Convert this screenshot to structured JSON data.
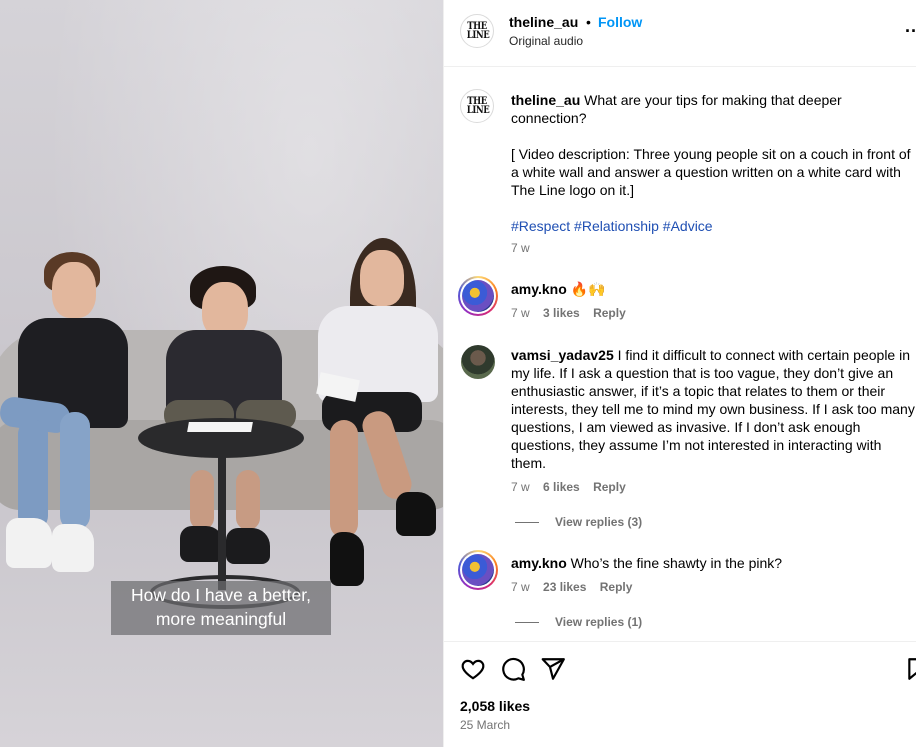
{
  "video": {
    "subtitle": "How do I have a better, more meaningful"
  },
  "header": {
    "logo_text": "THE LINE",
    "username": "theline_au",
    "separator": "•",
    "follow_label": "Follow",
    "audio_label": "Original audio",
    "more_label": "..."
  },
  "caption": {
    "logo_text": "THE LINE",
    "username": "theline_au",
    "text": "What are your tips for making that deeper connection?",
    "description": "[ Video description: Three young people sit on a couch in front of a white wall and answer a question written on a white card with The Line logo on it.]",
    "hashtags": [
      "#Respect",
      "#Relationship",
      "#Advice"
    ],
    "time": "7 w"
  },
  "comments": [
    {
      "username": "amy.kno",
      "text": "🔥🙌",
      "time": "7 w",
      "likes": "3 likes",
      "reply_label": "Reply",
      "view_replies": ""
    },
    {
      "username": "vamsi_yadav25",
      "text": "I find it difficult to connect with certain people in my life. If I ask a question that is too vague, they don’t give an enthusiastic answer, if it’s a topic that relates to them or their interests, they tell me to mind my own business. If I ask too many questions, I am viewed as invasive. If I don’t ask enough questions, they assume I’m not interested in interacting with them.",
      "time": "7 w",
      "likes": "6 likes",
      "reply_label": "Reply",
      "view_replies": "View replies (3)"
    },
    {
      "username": "amy.kno",
      "text": "Who’s the fine shawty in the pink?",
      "time": "7 w",
      "likes": "23 likes",
      "reply_label": "Reply",
      "view_replies": "View replies (1)"
    }
  ],
  "footer": {
    "likes": "2,058 likes",
    "date": "25 March",
    "icons": [
      "heart-icon",
      "comment-icon",
      "share-icon",
      "bookmark-icon"
    ]
  },
  "colors": {
    "follow": "#0095f6",
    "hashtag": "#1f4fb3",
    "meta": "#737373"
  }
}
